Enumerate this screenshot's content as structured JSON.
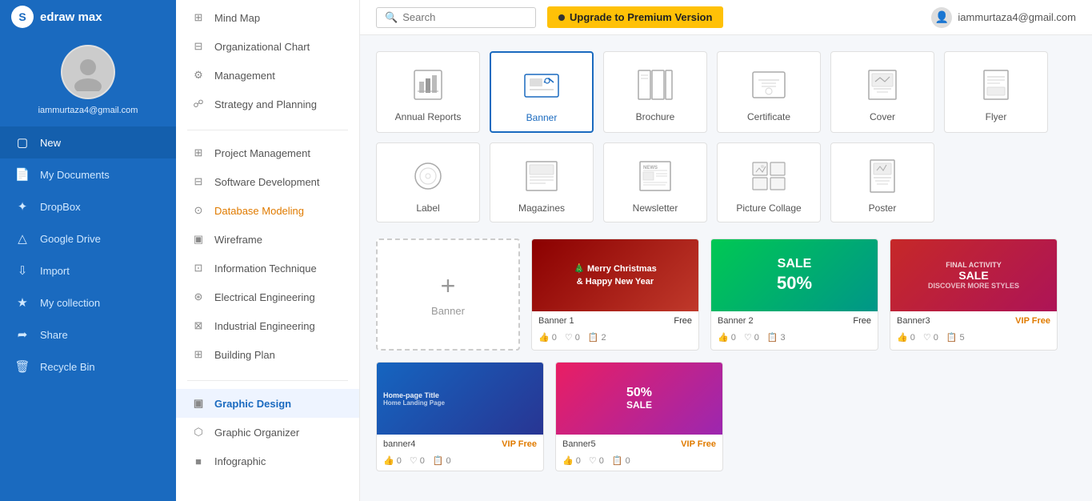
{
  "app": {
    "name": "edraw max"
  },
  "user": {
    "email": "iammurtaza4@gmail.com"
  },
  "topbar": {
    "search_placeholder": "Search",
    "upgrade_label": "Upgrade to Premium Version"
  },
  "sidebar_nav": [
    {
      "id": "new",
      "label": "New",
      "icon": "plus-square"
    },
    {
      "id": "my-documents",
      "label": "My Documents",
      "icon": "file"
    },
    {
      "id": "dropbox",
      "label": "DropBox",
      "icon": "dropbox"
    },
    {
      "id": "google-drive",
      "label": "Google Drive",
      "icon": "drive"
    },
    {
      "id": "import",
      "label": "Import",
      "icon": "import"
    },
    {
      "id": "my-collection",
      "label": "My collection",
      "icon": "star"
    },
    {
      "id": "share",
      "label": "Share",
      "icon": "share"
    },
    {
      "id": "recycle-bin",
      "label": "Recycle Bin",
      "icon": "trash"
    }
  ],
  "secondary_nav": {
    "sections": [
      {
        "items": [
          {
            "label": "Mind Map",
            "icon": "mindmap",
            "active": false
          },
          {
            "label": "Organizational Chart",
            "icon": "org",
            "active": false
          },
          {
            "label": "Management",
            "icon": "manage",
            "active": false
          },
          {
            "label": "Strategy and Planning",
            "icon": "strategy",
            "active": false
          }
        ]
      },
      {
        "items": [
          {
            "label": "Project Management",
            "icon": "project",
            "active": false
          },
          {
            "label": "Software Development",
            "icon": "software",
            "active": false
          },
          {
            "label": "Database Modeling",
            "icon": "database",
            "highlight": true,
            "active": false
          },
          {
            "label": "Wireframe",
            "icon": "wireframe",
            "active": false
          },
          {
            "label": "Information Technique",
            "icon": "info",
            "active": false
          },
          {
            "label": "Electrical Engineering",
            "icon": "electrical",
            "active": false
          },
          {
            "label": "Industrial Engineering",
            "icon": "industrial",
            "active": false
          },
          {
            "label": "Building Plan",
            "icon": "building",
            "active": false
          }
        ]
      },
      {
        "items": [
          {
            "label": "Graphic Design",
            "icon": "graphic",
            "active": true
          },
          {
            "label": "Graphic Organizer",
            "icon": "organizer",
            "active": false
          },
          {
            "label": "Infographic",
            "icon": "infographic",
            "active": false
          }
        ]
      }
    ]
  },
  "template_types": [
    {
      "id": "annual-reports",
      "label": "Annual Reports",
      "selected": false
    },
    {
      "id": "banner",
      "label": "Banner",
      "selected": true
    },
    {
      "id": "brochure",
      "label": "Brochure",
      "selected": false
    },
    {
      "id": "certificate",
      "label": "Certificate",
      "selected": false
    },
    {
      "id": "cover",
      "label": "Cover",
      "selected": false
    },
    {
      "id": "flyer",
      "label": "Flyer",
      "selected": false
    },
    {
      "id": "label",
      "label": "Label",
      "selected": false
    },
    {
      "id": "magazines",
      "label": "Magazines",
      "selected": false
    },
    {
      "id": "newsletter",
      "label": "Newsletter",
      "selected": false
    },
    {
      "id": "picture-collage",
      "label": "Picture Collage",
      "selected": false
    },
    {
      "id": "poster",
      "label": "Poster",
      "selected": false
    }
  ],
  "banner_templates": [
    {
      "id": "new",
      "type": "new",
      "label": "Banner"
    },
    {
      "id": "banner1",
      "title": "Banner 1",
      "badge": "Free",
      "badge_type": "free",
      "stats": {
        "likes": 0,
        "hearts": 0,
        "copies": 2
      },
      "color": "christmas"
    },
    {
      "id": "banner2",
      "title": "Banner 2",
      "badge": "Free",
      "badge_type": "free",
      "stats": {
        "likes": 0,
        "hearts": 0,
        "copies": 3
      },
      "color": "green-sale"
    },
    {
      "id": "banner3",
      "title": "Banner3",
      "badge": "VIP Free",
      "badge_type": "vip",
      "stats": {
        "likes": 0,
        "hearts": 0,
        "copies": 5
      },
      "color": "sale3"
    },
    {
      "id": "banner4",
      "title": "banner4",
      "badge": "VIP Free",
      "badge_type": "vip",
      "stats": {
        "likes": 0,
        "hearts": 0,
        "copies": 0
      },
      "color": "homepage"
    }
  ]
}
